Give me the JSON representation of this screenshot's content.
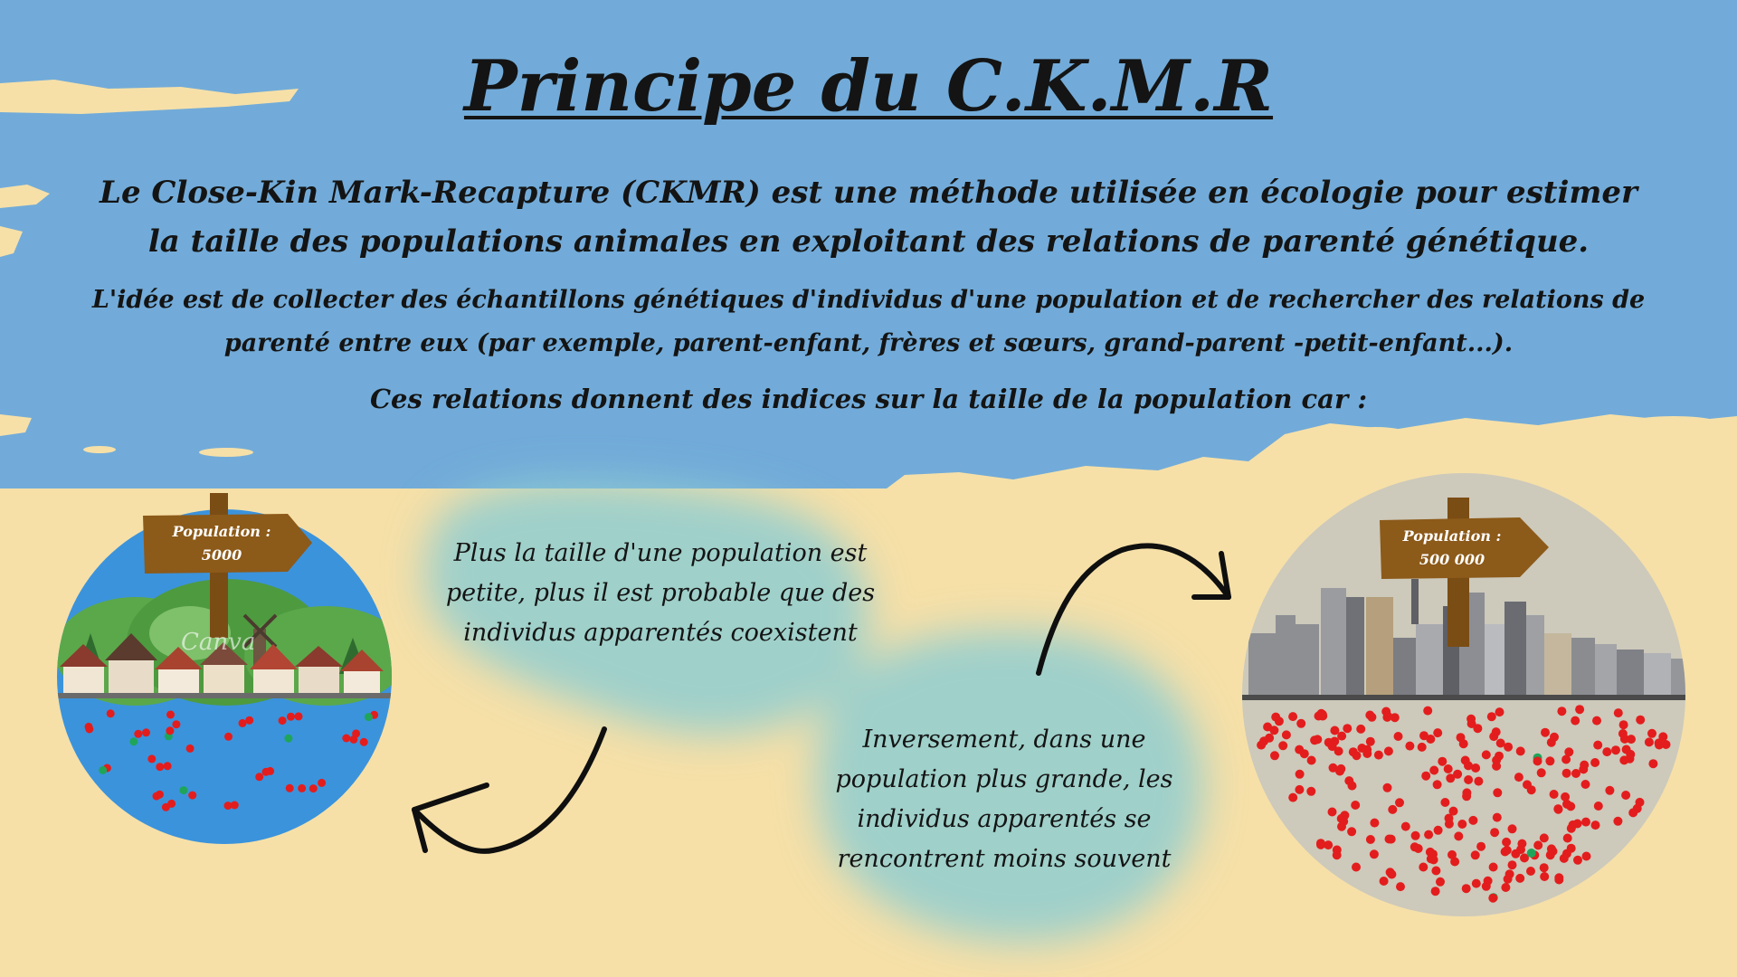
{
  "title": "Principe du C.K.M.R",
  "intro": "Le Close-Kin Mark-Recapture (CKMR) est une méthode utilisée en écologie pour estimer la taille des populations animales en exploitant des relations de parenté génétique.",
  "idea": "L'idée est de collecter des échantillons génétiques d'individus d'une population et de rechercher des relations de parenté entre eux (par exemple, parent-enfant, frères et sœurs, grand-parent -petit-enfant...).",
  "reason": "Ces relations donnent des indices sur la taille de la population car :",
  "small_population": {
    "sign_label": "Population :",
    "sign_value": "5000",
    "watermark": "Canva",
    "text": "Plus la taille d'une population est petite, plus il est probable que des individus apparentés coexistent"
  },
  "large_population": {
    "sign_label": "Population :",
    "sign_value": "500 000",
    "text": "Inversement, dans une population plus grande, les individus apparentés se rencontrent moins souvent"
  },
  "colors": {
    "sky": "#72abd9",
    "sand": "#f6e0a8",
    "teal_stain": "#8fcdd0",
    "water": "#3b93dc",
    "grey_circle": "#cdc9bb",
    "sign_wood": "#8c5a19",
    "dot_red": "#e31d1d",
    "dot_green": "#1fa55a"
  }
}
